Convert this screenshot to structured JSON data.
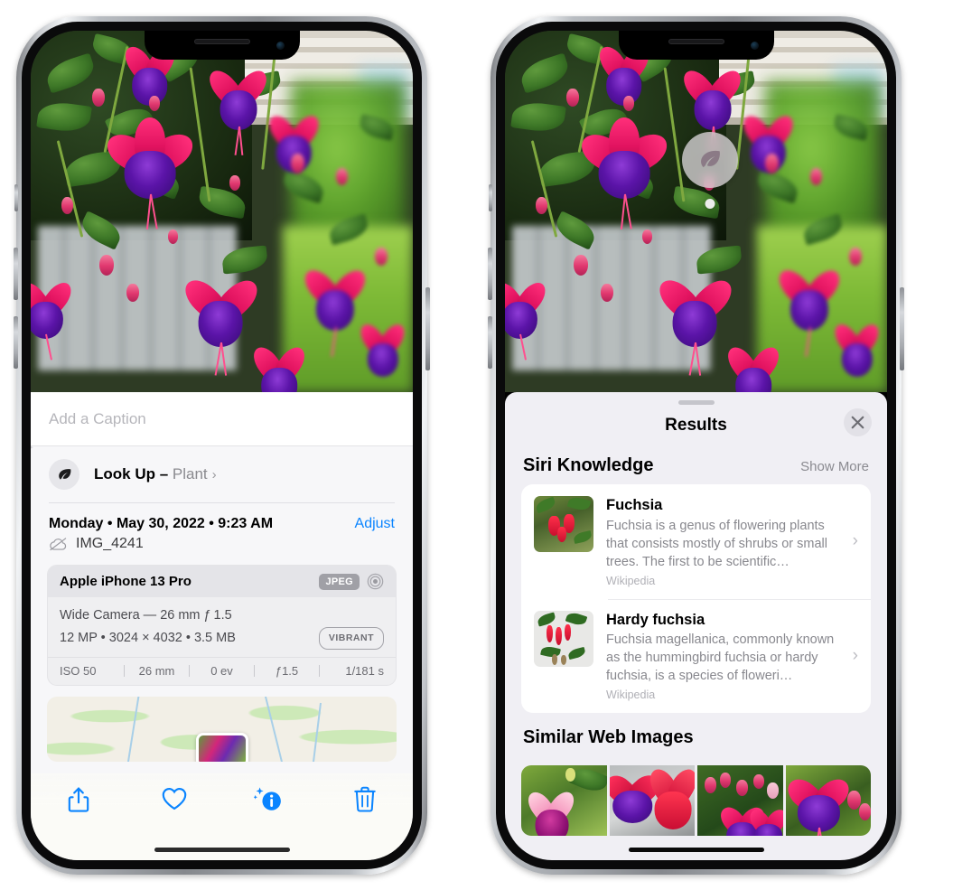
{
  "left_phone": {
    "photo": {
      "alt_name": "fuchsia-flowers-photo"
    },
    "caption_field": {
      "placeholder": "Add a Caption",
      "value": ""
    },
    "look_up": {
      "label_bold": "Look Up",
      "label_sep": " – ",
      "label_rest": "Plant",
      "chevron": "›",
      "icon": "leaf-icon",
      "sparkle": "✦"
    },
    "metadata": {
      "date": "Monday • May 30, 2022 • 9:23 AM",
      "adjust_label": "Adjust",
      "filename": "IMG_4241",
      "cloud_icon": "cloud-slash-icon"
    },
    "exif": {
      "device": "Apple iPhone 13 Pro",
      "format_badge": "JPEG",
      "aperture_icon": "aperture-icon",
      "lens_line": "Wide Camera — 26 mm ƒ 1.5",
      "size_line": "12 MP • 3024 × 4032 • 3.5 MB",
      "vibrant_badge": "VIBRANT",
      "stats": [
        "ISO 50",
        "26 mm",
        "0 ev",
        "ƒ1.5",
        "1/181 s"
      ]
    },
    "map": {
      "name": "location-map-thumbnail"
    },
    "toolbar": [
      {
        "name": "share-button",
        "icon": "share-icon",
        "active": false
      },
      {
        "name": "favorite-button",
        "icon": "heart-icon",
        "active": false
      },
      {
        "name": "info-button",
        "icon": "info-sparkle-icon",
        "active": true
      },
      {
        "name": "delete-button",
        "icon": "trash-icon",
        "active": false
      }
    ]
  },
  "right_phone": {
    "visual_lookup_badge": {
      "icon": "leaf-icon",
      "name": "visual-lookup-badge"
    },
    "sheet": {
      "grabber": "drag-handle",
      "title": "Results",
      "close_icon": "close-icon"
    },
    "siri_knowledge": {
      "section_title": "Siri Knowledge",
      "show_more": "Show More",
      "results": [
        {
          "title": "Fuchsia",
          "description": "Fuchsia is a genus of flowering plants that consists mostly of shrubs or small trees. The first to be scientific…",
          "source": "Wikipedia",
          "chevron": "›"
        },
        {
          "title": "Hardy fuchsia",
          "description": "Fuchsia magellanica, commonly known as the hummingbird fuchsia or hardy fuchsia, is a species of floweri…",
          "source": "Wikipedia",
          "chevron": "›"
        }
      ]
    },
    "similar_web_images": {
      "section_title": "Similar Web Images",
      "thumbnails": [
        {
          "name": "web-image-thumb-1"
        },
        {
          "name": "web-image-thumb-2"
        },
        {
          "name": "web-image-thumb-3"
        },
        {
          "name": "web-image-thumb-4"
        }
      ]
    }
  },
  "colors": {
    "accent_blue": "#0a84ff",
    "sheet_bg_left": "#f7f7f9",
    "sheet_bg_right": "#f0eff4",
    "card_bg": "#ffffff",
    "secondary_text": "#8a8a90",
    "exif_card_bg": "#efeff1"
  }
}
